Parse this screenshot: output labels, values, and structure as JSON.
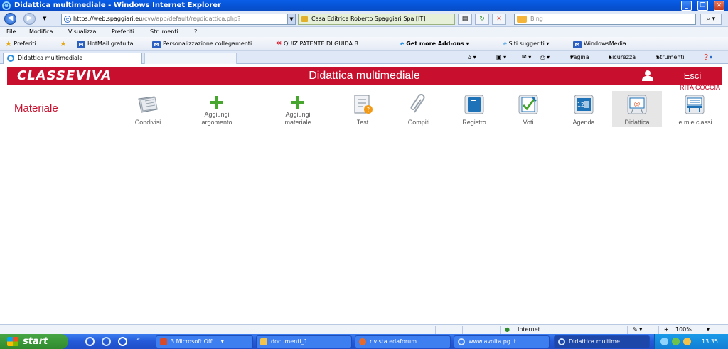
{
  "window": {
    "title": "Didattica multimediale - Windows Internet Explorer",
    "minimize": "_",
    "restore": "❐",
    "close": "✕"
  },
  "address": {
    "url_domain": "https://web.spaggiari.eu",
    "url_rest": "/cvv/app/default/regdidattica.php?",
    "certificate": "Casa Editrice Roberto Spaggiari Spa [IT]",
    "search_placeholder": "Bing"
  },
  "menu": [
    "File",
    "Modifica",
    "Visualizza",
    "Preferiti",
    "Strumenti",
    "?"
  ],
  "favorites": {
    "preferiti": "Preferiti",
    "items": [
      "HotMail gratuita",
      "Personalizzazione collegamenti",
      "QUIZ PATENTE DI GUIDA B ...",
      "Get more Add-ons",
      "Siti suggeriti",
      "WindowsMedia"
    ]
  },
  "tab": {
    "label": "Didattica multimediale"
  },
  "commandbar": [
    "Pagina",
    "Sicurezza",
    "Strumenti"
  ],
  "page": {
    "logo": "CLASSEVIVA",
    "title": "Didattica multimediale",
    "exit": "Esci",
    "user": "RITA COCCIA",
    "section": "Materiale",
    "tools": [
      {
        "label": "Condivisi"
      },
      {
        "label": "Aggiungi argomento",
        "l1": "Aggiungi",
        "l2": "argomento"
      },
      {
        "label": "Aggiungi materiale",
        "l1": "Aggiungi",
        "l2": "materiale"
      },
      {
        "label": "Test"
      },
      {
        "label": "Compiti"
      }
    ],
    "nav": [
      {
        "label": "Registro"
      },
      {
        "label": "Voti"
      },
      {
        "label": "Agenda"
      },
      {
        "label": "Didattica"
      },
      {
        "label": "le mie classi"
      }
    ]
  },
  "status": {
    "zone": "Internet",
    "zoom": "100%"
  },
  "taskbar": {
    "start": "start",
    "buttons": [
      "3 Microsoft Offi...",
      "documenti_1",
      "rivista.edaforum....",
      "www.avolta.pg.it...",
      "Didattica multime..."
    ],
    "clock": "13.35"
  }
}
